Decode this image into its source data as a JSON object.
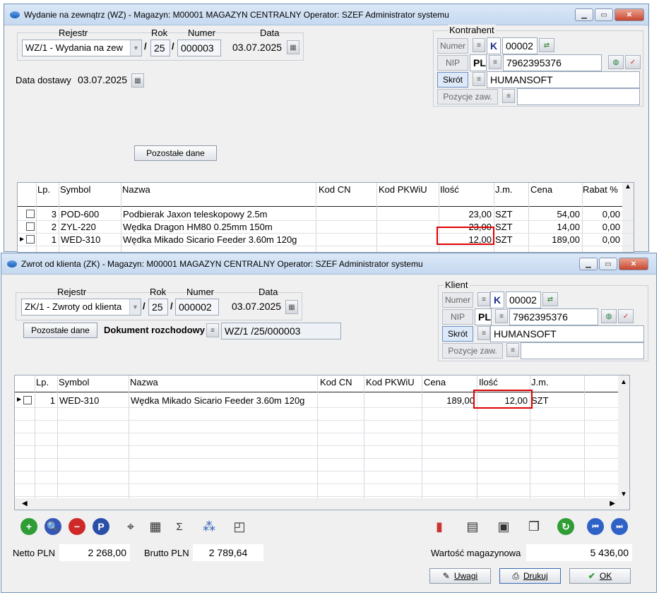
{
  "wz": {
    "title": "Wydanie na zewnątrz (WZ) - Magazyn: M00001 MAGAZYN CENTRALNY  Operator: SZEF Administrator systemu",
    "labels": {
      "rejestr": "Rejestr",
      "rok": "Rok",
      "numer": "Numer",
      "data": "Data",
      "data_dostawy": "Data dostawy",
      "kontrahent": "Kontrahent"
    },
    "rejestr": "WZ/1  - Wydania na zew",
    "rok": "25",
    "numer": "000003",
    "data": "03.07.2025",
    "data_dostawy": "03.07.2025",
    "kontrahent": {
      "numer_label": "Numer",
      "numer_type": "K",
      "numer": "00002",
      "nip_label": "NIP",
      "nip_prefix": "PL",
      "nip": "7962395376",
      "skrot_label": "Skrót",
      "skrot": "HUMANSOFT",
      "pozycje_label": "Pozycje zaw.",
      "pozycje": ""
    },
    "pozostale_label": "Pozostałe dane",
    "columns": [
      "Lp.",
      "Symbol",
      "Nazwa",
      "Kod CN",
      "Kod PKWiU",
      "Ilość",
      "J.m.",
      "Cena",
      "Rabat %"
    ],
    "rows": [
      {
        "lp": "3",
        "symbol": "POD-600",
        "nazwa": "Podbierak Jaxon teleskopowy 2.5m",
        "ilosc": "23,00",
        "jm": "SZT",
        "cena": "54,00",
        "rabat": "0,00"
      },
      {
        "lp": "2",
        "symbol": "ZYL-220",
        "nazwa": "Wędka Dragon HM80 0.25mm 150m",
        "ilosc": "23,00",
        "jm": "SZT",
        "cena": "14,00",
        "rabat": "0,00"
      },
      {
        "lp": "1",
        "symbol": "WED-310",
        "nazwa": "Wędka Mikado Sicario Feeder 3.60m 120g",
        "ilosc": "12,00",
        "jm": "SZT",
        "cena": "189,00",
        "rabat": "0,00"
      }
    ]
  },
  "zk": {
    "title": "Zwrot od klienta (ZK) - Magazyn: M00001 MAGAZYN CENTRALNY  Operator: SZEF Administrator systemu",
    "labels": {
      "rejestr": "Rejestr",
      "rok": "Rok",
      "numer": "Numer",
      "data": "Data",
      "klient": "Klient",
      "dok_rozch": "Dokument rozchodowy"
    },
    "rejestr": "ZK/1  - Zwroty od klienta",
    "rok": "25",
    "numer": "000002",
    "data": "03.07.2025",
    "dokument_rozchodowy": "WZ/1  /25/000003",
    "pozostale_label": "Pozostałe dane",
    "klient": {
      "numer_label": "Numer",
      "numer_type": "K",
      "numer": "00002",
      "nip_label": "NIP",
      "nip_prefix": "PL",
      "nip": "7962395376",
      "skrot_label": "Skrót",
      "skrot": "HUMANSOFT",
      "pozycje_label": "Pozycje zaw.",
      "pozycje": ""
    },
    "columns": [
      "Lp.",
      "Symbol",
      "Nazwa",
      "Kod CN",
      "Kod PKWiU",
      "Cena",
      "Ilość",
      "J.m."
    ],
    "rows": [
      {
        "lp": "1",
        "symbol": "WED-310",
        "nazwa": "Wędka Mikado Sicario Feeder 3.60m 120g",
        "cena": "189,00",
        "ilosc": "12,00",
        "jm": "SZT"
      }
    ],
    "footer": {
      "netto_label": "Netto PLN",
      "netto": "2 268,00",
      "brutto_label": "Brutto PLN",
      "brutto": "2 789,64",
      "wartosc_label": "Wartość magazynowa",
      "wartosc": "5 436,00"
    },
    "buttons": {
      "uwagi": "Uwagi",
      "drukuj": "Drukuj",
      "ok": "OK"
    }
  }
}
